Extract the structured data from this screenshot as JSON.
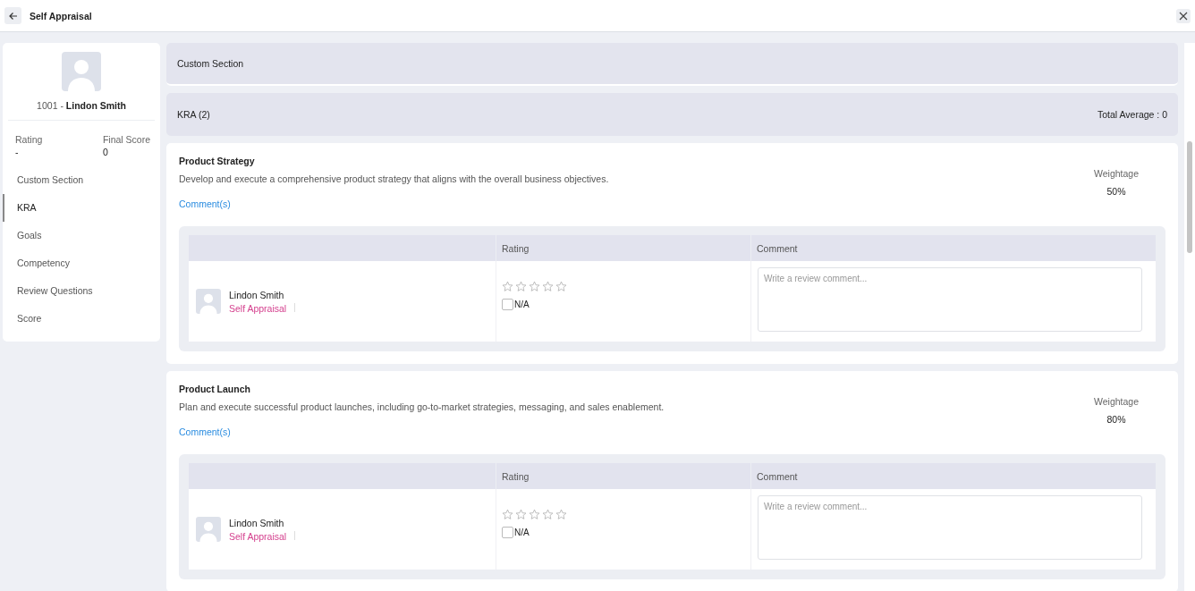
{
  "header": {
    "title": "Self Appraisal"
  },
  "profile": {
    "id": "1001 - ",
    "name": "Lindon Smith"
  },
  "summary": [
    {
      "label": "Rating",
      "value": "-"
    },
    {
      "label": "Final Score",
      "value": "0"
    }
  ],
  "sidebar": {
    "items": [
      {
        "label": "Custom Section",
        "selected": false
      },
      {
        "label": "KRA",
        "selected": true
      },
      {
        "label": "Goals",
        "selected": false
      },
      {
        "label": "Competency",
        "selected": false
      },
      {
        "label": "Review Questions",
        "selected": false
      },
      {
        "label": "Score",
        "selected": false
      }
    ]
  },
  "sections": [
    {
      "title": "Custom Section"
    },
    {
      "title": "KRA (2)",
      "total_label": "Total Average :",
      "total_value": "0"
    }
  ],
  "kras": [
    {
      "title": "Product Strategy",
      "description": "Develop and execute a comprehensive product strategy that aligns with the overall business objectives.",
      "comments_link": "Comment(s)",
      "weightage_label": "Weightage",
      "weightage": "50%",
      "columns": [
        "Rating",
        "Comment"
      ],
      "reviewer": {
        "name": "Lindon Smith",
        "role": "Self Appraisal",
        "stars": 0,
        "na_label": "N/A",
        "na_checked": false,
        "comment_placeholder": "Write a review comment..."
      }
    },
    {
      "title": "Product Launch",
      "description": "Plan and execute successful product launches, including go-to-market strategies, messaging, and sales enablement.",
      "comments_link": "Comment(s)",
      "weightage_label": "Weightage",
      "weightage": "80%",
      "columns": [
        "Rating",
        "Comment"
      ],
      "reviewer": {
        "name": "Lindon Smith",
        "role": "Self Appraisal",
        "stars": 0,
        "na_label": "N/A",
        "na_checked": false,
        "comment_placeholder": "Write a review comment..."
      }
    }
  ]
}
